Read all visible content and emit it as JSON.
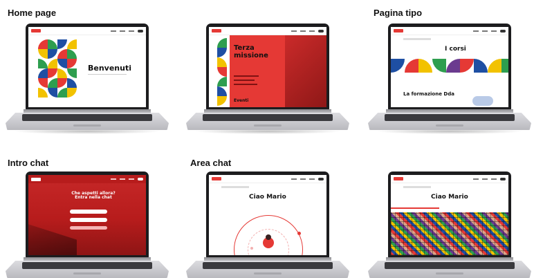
{
  "labels": {
    "home_page": "Home page",
    "pagina_tipo": "Pagina tipo",
    "intro_chat": "Intro chat",
    "area_chat": "Area chat"
  },
  "screens": {
    "home": {
      "title": "Benvenuti"
    },
    "terza": {
      "title": "Terza missione",
      "footer_text": "Eventi"
    },
    "corsi": {
      "title": "I corsi",
      "subtitle": "La formazione Dda"
    },
    "intro": {
      "title": "Che aspetti allora? Entra nella chat"
    },
    "area1": {
      "title": "Ciao Mario"
    },
    "area2": {
      "title": "Ciao Mario"
    }
  },
  "colors": {
    "brand_red": "#e53935",
    "dark_red": "#b71c1c",
    "blue": "#1e4fa3",
    "yellow": "#f2c200",
    "green": "#2e9e4f",
    "laptop_black": "#1c1c1e"
  }
}
